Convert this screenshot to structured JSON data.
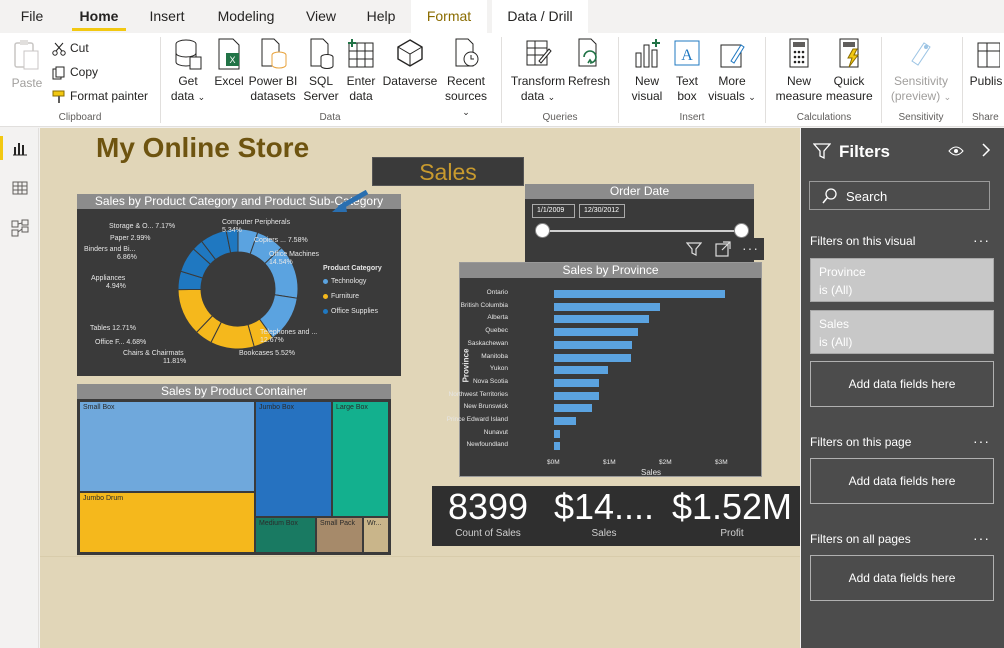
{
  "tabs": [
    "File",
    "Home",
    "Insert",
    "Modeling",
    "View",
    "Help",
    "Format",
    "Data / Drill"
  ],
  "ribbon": {
    "clipboard": {
      "paste": "Paste",
      "cut": "Cut",
      "copy": "Copy",
      "format_painter": "Format painter",
      "group": "Clipboard"
    },
    "data": {
      "get_data_1": "Get",
      "get_data_2": "data",
      "excel": "Excel",
      "powerbi_1": "Power BI",
      "powerbi_2": "datasets",
      "sql_1": "SQL",
      "sql_2": "Server",
      "enter_1": "Enter",
      "enter_2": "data",
      "dataverse": "Dataverse",
      "recent_1": "Recent",
      "recent_2": "sources",
      "group": "Data"
    },
    "queries": {
      "transform_1": "Transform",
      "transform_2": "data",
      "refresh": "Refresh",
      "group": "Queries"
    },
    "insert": {
      "new_visual_1": "New",
      "new_visual_2": "visual",
      "text_box_1": "Text",
      "text_box_2": "box",
      "more_visuals_1": "More",
      "more_visuals_2": "visuals",
      "group": "Insert"
    },
    "calculations": {
      "new_measure_1": "New",
      "new_measure_2": "measure",
      "quick_measure_1": "Quick",
      "quick_measure_2": "measure",
      "group": "Calculations"
    },
    "sensitivity": {
      "label_1": "Sensitivity",
      "label_2": "(preview)",
      "group": "Sensitivity"
    },
    "share": {
      "publish": "Publis",
      "group": "Share"
    }
  },
  "canvas": {
    "title": "My Online Store",
    "banner": "Sales",
    "donut": {
      "title": "Sales by Product Category and Product Sub-Category",
      "legend_title": "Product Category",
      "legend": [
        "Technology",
        "Furniture",
        "Office Supplies"
      ],
      "labels": {
        "storage": "Storage & O...  7.17%",
        "paper": "Paper 2.99%",
        "binders": "Binders and Bi...",
        "binders_pct": "6.86%",
        "appliances": "Appliances",
        "appliances_pct": "4.94%",
        "computer": "Computer Peripherals",
        "computer_pct": "5.34%",
        "copiers": "Copiers ...  7.58%",
        "office_machines": "Office Machines",
        "office_machines_pct": "14.54%",
        "tables": "Tables 12.71%",
        "office_f": "Office F...  4.68%",
        "chairs": "Chairs & Chairmats",
        "chairs_pct": "11.81%",
        "telephones": "Telephones and ...",
        "telephones_pct": "12.67%",
        "bookcases": "Bookcases 5.52%"
      },
      "colors": {
        "technology": "#5ba3e0",
        "furniture": "#f5b81c",
        "office_supplies": "#1f78c1"
      }
    },
    "treemap": {
      "title": "Sales by Product Container",
      "tiles": [
        "Small Box",
        "Jumbo Box",
        "Large Box",
        "Jumbo Drum",
        "Medium Box",
        "Small Pack",
        "Wr..."
      ]
    },
    "order_date": {
      "title": "Order Date",
      "start": "1/1/2009",
      "end": "12/30/2012"
    },
    "province": {
      "title": "Sales by Province",
      "ylabel": "Province",
      "xlabel": "Sales",
      "xticks": [
        "$0M",
        "$1M",
        "$2M",
        "$3M"
      ]
    },
    "kpis": [
      {
        "value": "8399",
        "label": "Count of Sales"
      },
      {
        "value": "$14....",
        "label": "Sales"
      },
      {
        "value": "$1.52M",
        "label": "Profit"
      }
    ]
  },
  "chart_data": {
    "type": "bar",
    "orientation": "horizontal",
    "title": "Sales by Province",
    "xlabel": "Sales",
    "ylabel": "Province",
    "categories": [
      "Ontario",
      "British Columbia",
      "Alberta",
      "Quebec",
      "Saskachewan",
      "Manitoba",
      "Yukon",
      "Nova Scotia",
      "Northwest Territories",
      "New Brunswick",
      "Prince Edward Island",
      "Nunavut",
      "Newfoundland"
    ],
    "values": [
      3.06,
      1.9,
      1.7,
      1.5,
      1.4,
      1.37,
      0.97,
      0.8,
      0.8,
      0.68,
      0.4,
      0.1,
      0.1
    ],
    "units": "$M",
    "xlim": [
      0,
      3.3
    ]
  },
  "filters": {
    "title": "Filters",
    "search_placeholder": "Search",
    "on_visual": "Filters on this visual",
    "cards": [
      {
        "field": "Province",
        "state": "is (All)"
      },
      {
        "field": "Sales",
        "state": "is (All)"
      }
    ],
    "add_fields": "Add data fields here",
    "on_page": "Filters on this page",
    "on_all_pages": "Filters on all pages"
  }
}
